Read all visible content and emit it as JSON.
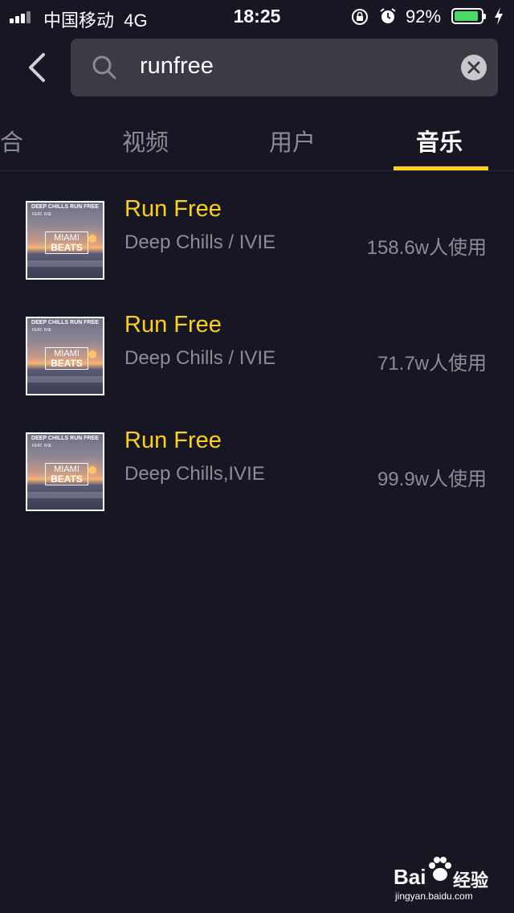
{
  "status_bar": {
    "carrier": "中国移动",
    "network": "4G",
    "time": "18:25",
    "battery_percent": "92%",
    "battery_level": 0.92,
    "icons": [
      "signal-icon",
      "rotation-lock-icon",
      "alarm-icon",
      "battery-icon",
      "charging-icon"
    ]
  },
  "header": {
    "back_icon": "chevron-left-icon",
    "search_icon": "search-icon",
    "search_value": "runfree",
    "clear_icon": "clear-icon"
  },
  "tabs": [
    {
      "label": "合",
      "active": false
    },
    {
      "label": "视频",
      "active": false
    },
    {
      "label": "用户",
      "active": false
    },
    {
      "label": "音乐",
      "active": true
    }
  ],
  "music_results": [
    {
      "title": "Run Free",
      "artist": "Deep Chills / IVIE",
      "uses": "158.6w人使用"
    },
    {
      "title": "Run Free",
      "artist": "Deep Chills / IVIE",
      "uses": "71.7w人使用"
    },
    {
      "title": "Run Free",
      "artist": "Deep Chills,IVIE",
      "uses": "99.9w人使用"
    }
  ],
  "album_art": {
    "band_text": "DEEP CHILLS RUN FREE",
    "feat_text": "FEAT. IVIE",
    "logo_line1": "MIAMI",
    "logo_line2": "BEATS"
  },
  "watermark": {
    "brand": "Bai",
    "cn": "经验",
    "url": "jingyan.baidu.com"
  },
  "colors": {
    "background": "#161722",
    "accent": "#fcd119",
    "muted_text": "#8b8c96",
    "search_bg": "#3a3b44",
    "battery_green": "#4cd964"
  }
}
